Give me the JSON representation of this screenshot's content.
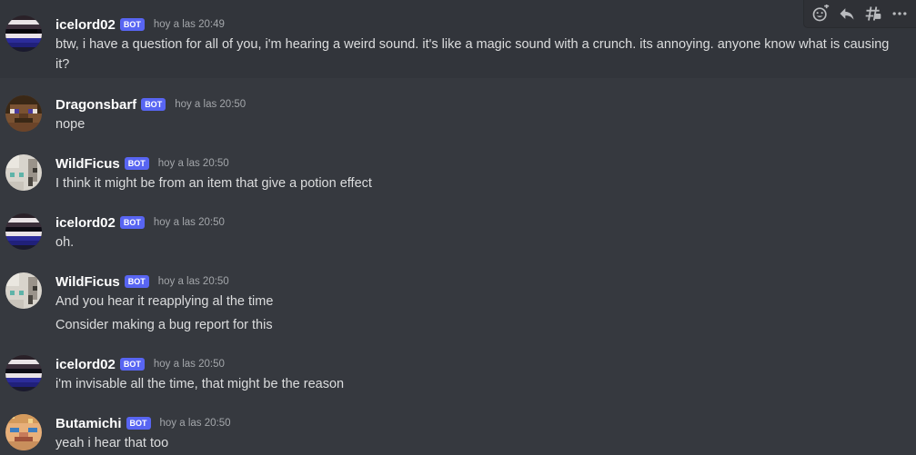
{
  "bot_tag": "BOT",
  "toolbar": {
    "add_reaction_icon": "add-reaction-icon",
    "reply_icon": "reply-icon",
    "create_thread_icon": "thread-icon",
    "more_icon": "more-icon"
  },
  "messages": [
    {
      "username": "icelord02",
      "timestamp": "hoy a las 20:49",
      "avatar": "icelord02-avatar",
      "lines": [
        "btw, i have a question for all of you, i'm hearing a weird sound. it's like a magic sound with a crunch. its annoying. anyone know what is causing it?"
      ]
    },
    {
      "username": "Dragonsbarf",
      "timestamp": "hoy a las 20:50",
      "avatar": "dragonsbarf-avatar",
      "lines": [
        "nope"
      ]
    },
    {
      "username": "WildFicus",
      "timestamp": "hoy a las 20:50",
      "avatar": "wildficus-avatar",
      "lines": [
        "I think it might be from an item that give a potion effect"
      ]
    },
    {
      "username": "icelord02",
      "timestamp": "hoy a las 20:50",
      "avatar": "icelord02-avatar",
      "lines": [
        "oh."
      ]
    },
    {
      "username": "WildFicus",
      "timestamp": "hoy a las 20:50",
      "avatar": "wildficus-avatar",
      "lines": [
        "And you hear it reapplying al the time",
        "Consider making a bug report for this"
      ]
    },
    {
      "username": "icelord02",
      "timestamp": "hoy a las 20:50",
      "avatar": "icelord02-avatar",
      "lines": [
        "i'm invisable all the time, that might be the reason"
      ]
    },
    {
      "username": "Butamichi",
      "timestamp": "hoy a las 20:50",
      "avatar": "butamichi-avatar",
      "lines": [
        "yeah i hear that too"
      ]
    }
  ]
}
